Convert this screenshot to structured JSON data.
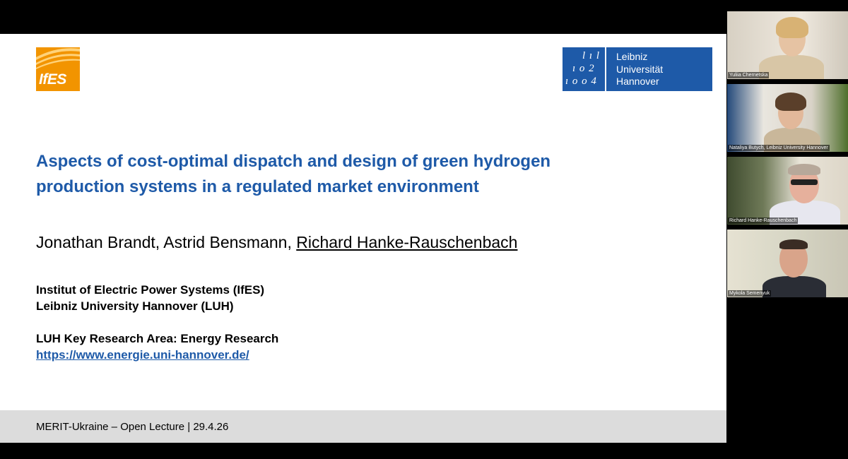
{
  "slide": {
    "logo_left_text": "IfES",
    "logo_right_lines": [
      "Leibniz",
      "Universität",
      "Hannover"
    ],
    "logo_right_mark": [
      "l ı l",
      "ı o 2",
      "ı o o 4"
    ],
    "title_line1": "Aspects of cost-optimal dispatch and design of green hydrogen",
    "title_line2": "production systems in a regulated market environment",
    "authors_plain": "Jonathan Brandt, Astrid Bensmann, ",
    "authors_underlined": "Richard Hanke-Rauschenbach",
    "institute_line1": "Institut of Electric Power Systems (IfES)",
    "institute_line2": "Leibniz University Hannover (LUH)",
    "research_area": "LUH Key Research Area: Energy Research",
    "research_link": "https://www.energie.uni-hannover.de/",
    "footer": "MERIT-Ukraine – Open Lecture | 29.4.26"
  },
  "participants": [
    {
      "name": "Yuliia Chernetska"
    },
    {
      "name": "Nataliya Butych, Leibniz University Hannover"
    },
    {
      "name": "Richard Hanke-Rauschenbach"
    },
    {
      "name": "Mykola Semenyuk"
    }
  ],
  "colors": {
    "luh_blue": "#1e5aa8",
    "ifes_orange": "#f29400",
    "footer_gray": "#dcdcdc",
    "active_speaker": "#2f8cff"
  },
  "icons": {
    "ifes": "ifes-logo-icon",
    "luh": "luh-logo-icon"
  }
}
